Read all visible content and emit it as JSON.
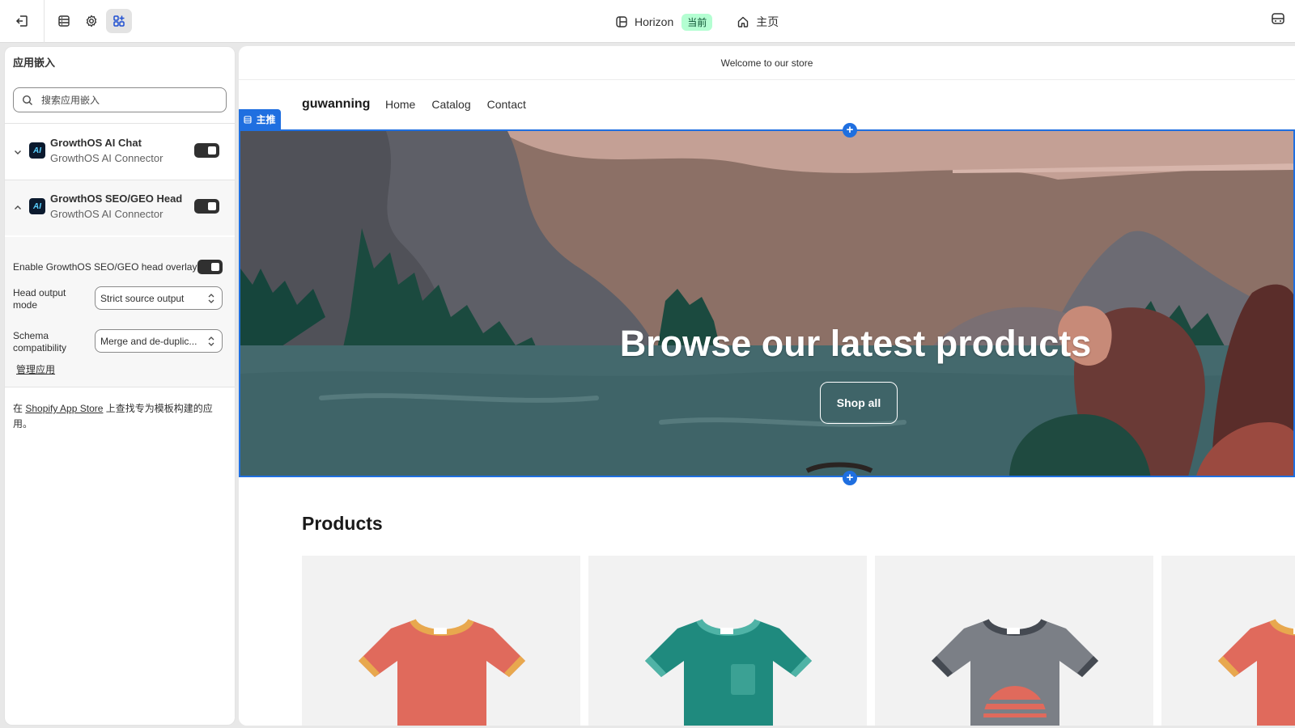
{
  "topbar": {
    "theme_name": "Horizon",
    "theme_badge": "当前",
    "page_label": "主页"
  },
  "sidebar": {
    "title": "应用嵌入",
    "search_placeholder": "搜索应用嵌入",
    "embeds": [
      {
        "name": "GrowthOS AI Chat",
        "subtitle": "GrowthOS AI Connector",
        "icon": "AI",
        "enabled": true,
        "expanded": false
      },
      {
        "name": "GrowthOS SEO/GEO Head",
        "subtitle": "GrowthOS AI Connector",
        "icon": "AI",
        "enabled": true,
        "expanded": true
      }
    ],
    "settings": {
      "overlay_label": "Enable GrowthOS SEO/GEO head overlay",
      "overlay_enabled": true,
      "head_output_label_1": "Head output",
      "head_output_label_2": "mode",
      "head_output_value": "Strict source output",
      "schema_label_1": "Schema",
      "schema_label_2": "compatibility",
      "schema_value": "Merge and de-duplic..."
    },
    "manage_link": "管理应用",
    "footer_prefix": "在 ",
    "footer_link": "Shopify App Store",
    "footer_suffix": " 上查找专为模板构建的应用。"
  },
  "preview": {
    "announcement": "Welcome to our store",
    "store_name": "guwanning",
    "nav": [
      "Home",
      "Catalog",
      "Contact"
    ],
    "section_tag": "主推",
    "hero_title": "Browse our latest products",
    "hero_button": "Shop all",
    "products_title": "Products"
  }
}
